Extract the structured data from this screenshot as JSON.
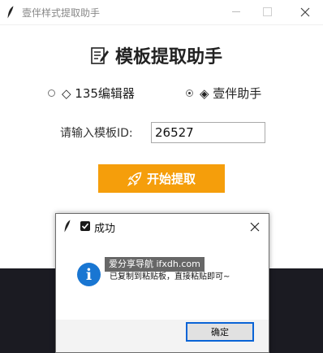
{
  "window": {
    "title": "壹伴样式提取助手",
    "app_icon": "feather-icon",
    "controls": [
      "minimize-icon",
      "maximize-icon",
      "close-icon"
    ]
  },
  "header": {
    "icon": "memo-icon",
    "title": "模板提取助手"
  },
  "options": {
    "items": [
      {
        "label": "◇ 135编辑器",
        "checked": false
      },
      {
        "label": "◈ 壹伴助手",
        "checked": true
      }
    ]
  },
  "template_field": {
    "label": "请输入模板ID:",
    "value": "26527"
  },
  "start_button": {
    "icon": "rocket-icon",
    "label": "开始提取",
    "color": "#f59e0b"
  },
  "dialog": {
    "title": "成功",
    "title_icon": "check-box-icon",
    "icon": "info-icon",
    "message": "已复制到粘贴板，直接粘贴即可~",
    "watermark": "爱分享导航 ifxdh.com",
    "ok_label": "确定",
    "info_color": "#1976d2"
  }
}
